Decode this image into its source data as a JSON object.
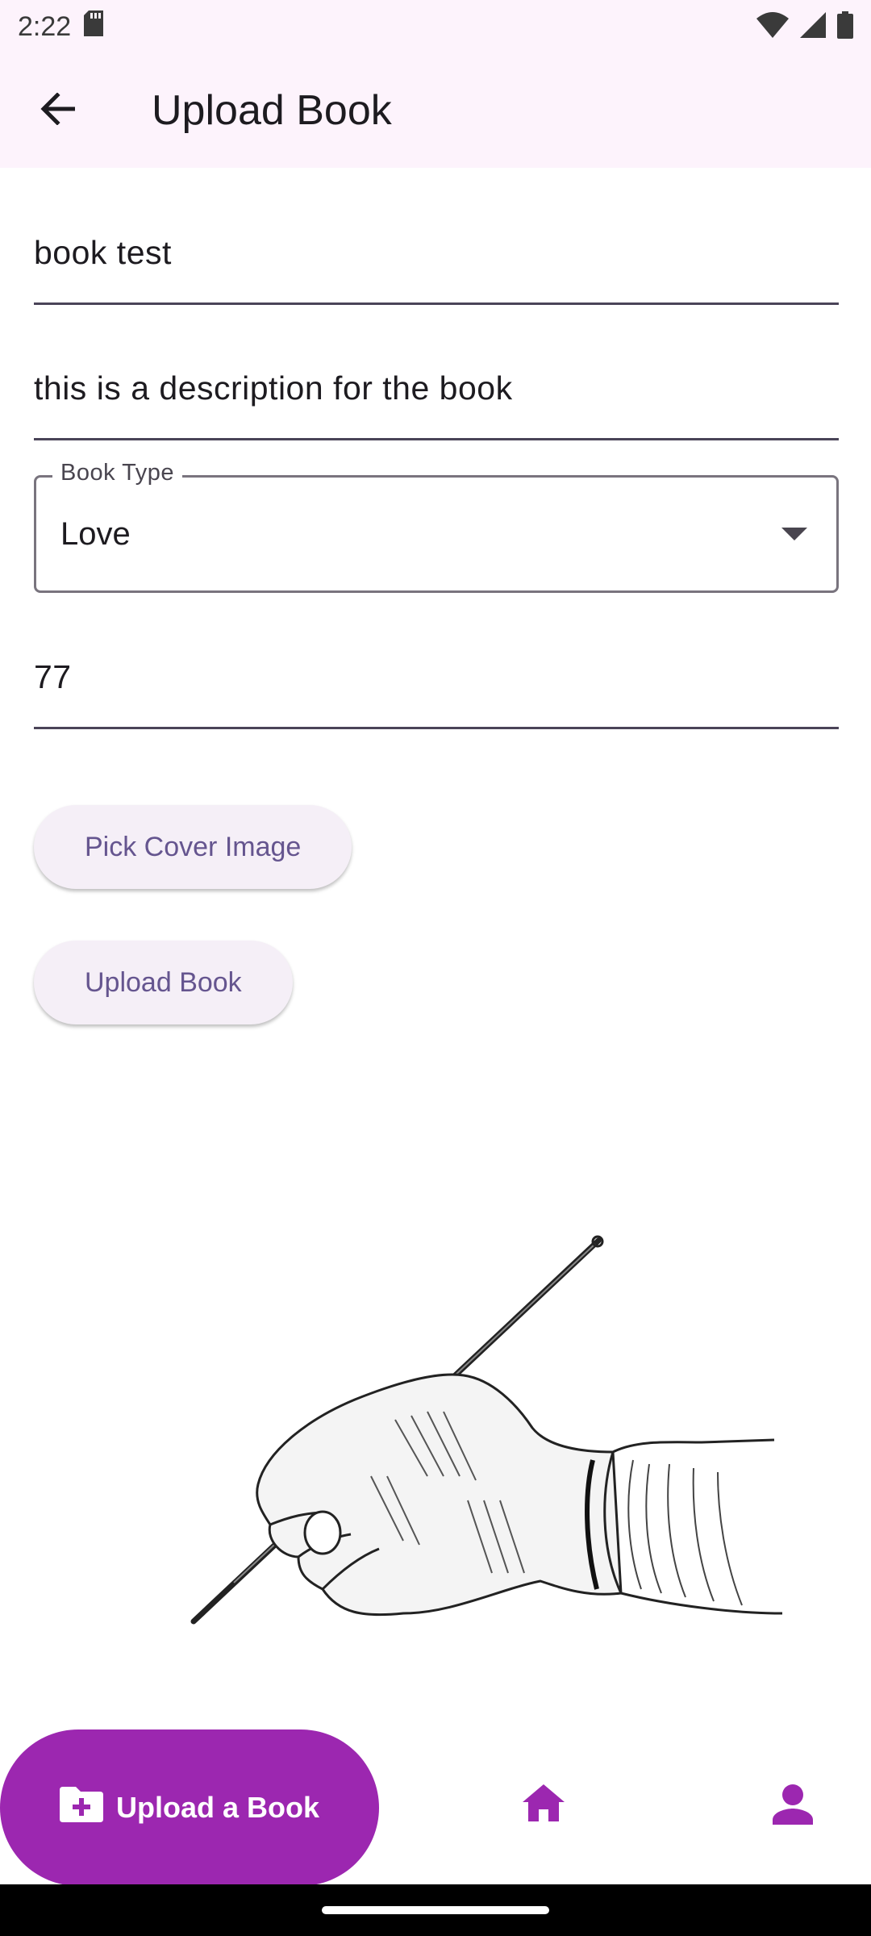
{
  "status_bar": {
    "time": "2:22",
    "icons": [
      "sd-card-icon",
      "wifi-icon",
      "cell-signal-icon",
      "battery-icon"
    ]
  },
  "app_bar": {
    "title": "Upload Book",
    "back_icon": "arrow-back-icon"
  },
  "form": {
    "title_value": "book test",
    "description_value": "this is a description for the book",
    "book_type": {
      "label": "Book Type",
      "selected": "Love"
    },
    "price_value": "77"
  },
  "actions": {
    "pick_cover_label": "Pick Cover Image",
    "upload_label": "Upload Book"
  },
  "bottom_nav": {
    "upload_tab_label": "Upload a Book",
    "upload_icon": "create-new-folder-icon",
    "home_icon": "home-icon",
    "profile_icon": "person-icon",
    "accent": "#9c27b0"
  },
  "colors": {
    "app_bar_bg": "#fdf3fc",
    "tonal_button_bg": "#f5eff7",
    "tonal_button_text": "#65558f"
  }
}
